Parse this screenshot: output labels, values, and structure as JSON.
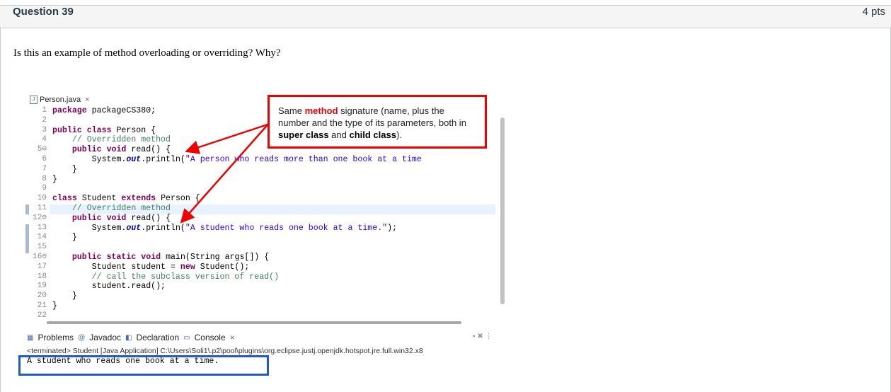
{
  "question": {
    "title": "Question 39",
    "points": "4 pts",
    "text": "Is this an example of method overloading or overriding? Why?"
  },
  "editor": {
    "tab_label": "Person.java",
    "tab_close": "×",
    "line_numbers": [
      "1",
      "2",
      "3",
      "4",
      "5⊖",
      "6",
      "7",
      "8",
      "9",
      "10",
      "11",
      "12⊖",
      "13",
      "14",
      "15",
      "16⊖",
      "17",
      "18",
      "19",
      "20",
      "21",
      "22"
    ],
    "lines": [
      [
        {
          "t": "package",
          "c": "kw"
        },
        {
          "t": " packageCS380;",
          "c": ""
        }
      ],
      [],
      [
        {
          "t": "public",
          "c": "kw"
        },
        {
          "t": " ",
          "c": ""
        },
        {
          "t": "class",
          "c": "kw"
        },
        {
          "t": " Person {",
          "c": ""
        }
      ],
      [
        {
          "t": "    // Overridden method",
          "c": "cm"
        }
      ],
      [
        {
          "t": "    ",
          "c": ""
        },
        {
          "t": "public",
          "c": "kw"
        },
        {
          "t": " ",
          "c": ""
        },
        {
          "t": "void",
          "c": "kw"
        },
        {
          "t": " read() {",
          "c": ""
        }
      ],
      [
        {
          "t": "        System.",
          "c": ""
        },
        {
          "t": "out",
          "c": "fld"
        },
        {
          "t": ".println(",
          "c": ""
        },
        {
          "t": "\"A person who reads more than one book at a time",
          "c": "st"
        }
      ],
      [
        {
          "t": "    }",
          "c": ""
        }
      ],
      [
        {
          "t": "}",
          "c": ""
        }
      ],
      [],
      [
        {
          "t": "class",
          "c": "kw"
        },
        {
          "t": " Student ",
          "c": ""
        },
        {
          "t": "extends",
          "c": "kw"
        },
        {
          "t": " Person {",
          "c": ""
        }
      ],
      [
        {
          "t": "    // Overridden method",
          "c": "cm"
        }
      ],
      [
        {
          "t": "    ",
          "c": ""
        },
        {
          "t": "public",
          "c": "kw"
        },
        {
          "t": " ",
          "c": ""
        },
        {
          "t": "void",
          "c": "kw"
        },
        {
          "t": " read() {",
          "c": ""
        }
      ],
      [
        {
          "t": "        System.",
          "c": ""
        },
        {
          "t": "out",
          "c": "fld"
        },
        {
          "t": ".println(",
          "c": ""
        },
        {
          "t": "\"A student who reads one book at a time.\"",
          "c": "st"
        },
        {
          "t": ");",
          "c": ""
        }
      ],
      [
        {
          "t": "    }",
          "c": ""
        }
      ],
      [],
      [
        {
          "t": "    ",
          "c": ""
        },
        {
          "t": "public",
          "c": "kw"
        },
        {
          "t": " ",
          "c": ""
        },
        {
          "t": "static",
          "c": "kw"
        },
        {
          "t": " ",
          "c": ""
        },
        {
          "t": "void",
          "c": "kw"
        },
        {
          "t": " main(String args[]) {",
          "c": ""
        }
      ],
      [
        {
          "t": "        Student student = ",
          "c": ""
        },
        {
          "t": "new",
          "c": "kw"
        },
        {
          "t": " Student();",
          "c": ""
        }
      ],
      [
        {
          "t": "        // call the subclass version of read()",
          "c": "cm"
        }
      ],
      [
        {
          "t": "        student.read();",
          "c": ""
        }
      ],
      [
        {
          "t": "    }",
          "c": ""
        }
      ],
      [
        {
          "t": "}",
          "c": ""
        }
      ],
      []
    ]
  },
  "callout": {
    "pre": "Same ",
    "highlight": "method",
    "mid1": " signature (name, plus the number and the type of its parameters, both in ",
    "bold1": "super class",
    "mid2": " and ",
    "bold2": "child class",
    "post": ")."
  },
  "console": {
    "tabs": [
      "Problems",
      "Javadoc",
      "Declaration",
      "Console"
    ],
    "console_close": "×",
    "terminated_line": "<terminated> Student [Java Application] C:\\Users\\Soli1\\.p2\\pool\\plugins\\org.eclipse.justj.openjdk.hotspot.jre.full.win32.x8",
    "output": "A student who reads one book at a time."
  },
  "colors": {
    "callout_border": "#ee0000",
    "output_border": "#1f5bcc",
    "arrow": "#ee0000"
  }
}
